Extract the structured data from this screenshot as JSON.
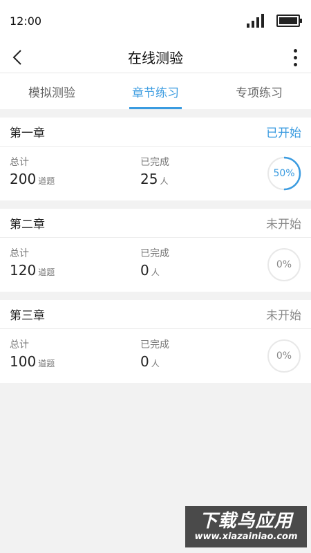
{
  "status_bar": {
    "time": "12:00",
    "icons": [
      "signal-icon",
      "battery-icon"
    ]
  },
  "navbar": {
    "title": "在线测验",
    "back_icon": "chevron-left-icon",
    "more_icon": "more-vertical-icon"
  },
  "tabs": [
    {
      "label": "模拟测验",
      "active": false
    },
    {
      "label": "章节练习",
      "active": true
    },
    {
      "label": "专项练习",
      "active": false
    }
  ],
  "chapters": [
    {
      "title": "第一章",
      "status": "已开始",
      "total_label": "总计",
      "total": "200",
      "total_unit": "道题",
      "done_label": "已完成",
      "done": "25",
      "done_unit": "人",
      "progress_text": "50%",
      "progress": 0.5
    },
    {
      "title": "第二章",
      "status": "未开始",
      "total_label": "总计",
      "total": "120",
      "total_unit": "道题",
      "done_label": "已完成",
      "done": "0",
      "done_unit": "人",
      "progress_text": "0%",
      "progress": 0
    },
    {
      "title": "第三章",
      "status": "未开始",
      "total_label": "总计",
      "total": "100",
      "total_unit": "道题",
      "done_label": "已完成",
      "done": "0",
      "done_unit": "人",
      "progress_text": "0%",
      "progress": 0
    }
  ],
  "watermark": {
    "logo_text": "下载鸟应用",
    "url": "www.xiazainiao.com"
  },
  "colors": {
    "accent": "#3a9be0",
    "ring_track": "#e8e8e8",
    "background": "#f2f2f2"
  }
}
